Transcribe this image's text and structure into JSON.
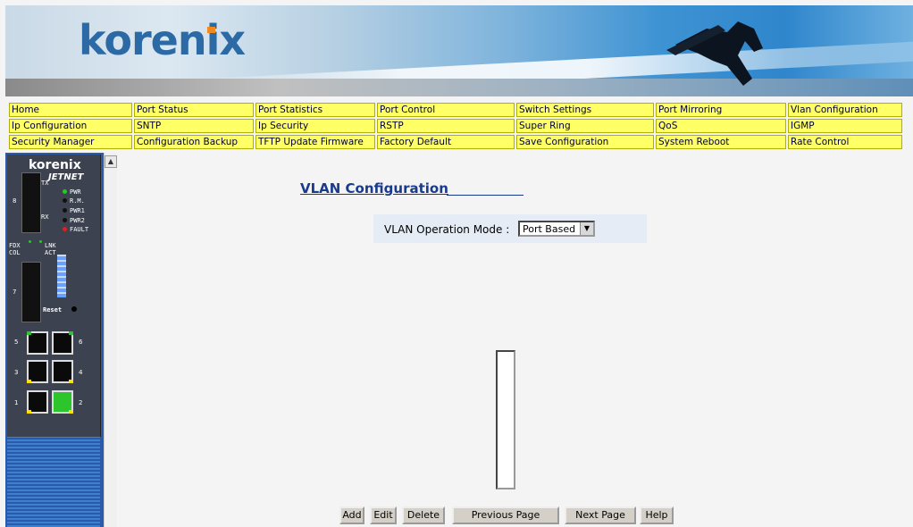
{
  "brand": {
    "logo_text": "korenix"
  },
  "menu": {
    "rows": [
      [
        "Home",
        "Port Status",
        "Port Statistics",
        "Port Control",
        "Switch Settings",
        "Port Mirroring",
        "Vlan Configuration"
      ],
      [
        "Ip Configuration",
        "SNTP",
        "Ip Security",
        "RSTP",
        "Super Ring",
        "QoS",
        "IGMP"
      ],
      [
        "Security Manager",
        "Configuration Backup",
        "TFTP Update Firmware",
        "Factory Default",
        "Save Configuration",
        "System Reboot",
        "Rate Control"
      ]
    ]
  },
  "device": {
    "logo": "korenix",
    "model": "JETNET",
    "leds": [
      "PWR",
      "R.M.",
      "PWR1",
      "PWR2",
      "FAULT"
    ],
    "fdx_label": "FDX COL",
    "lnk_label": "LNK ACT",
    "reset_label": "Reset",
    "fiber_tx": "TX",
    "fiber_rx": "RX",
    "ports": [
      "8",
      "7",
      "5",
      "6",
      "3",
      "4",
      "1",
      "2"
    ]
  },
  "main": {
    "title": "VLAN Configuration",
    "mode_label": "VLAN Operation Mode :",
    "mode_value": "Port Based"
  },
  "buttons": {
    "add": "Add",
    "edit": "Edit",
    "delete": "Delete",
    "previous": "Previous Page",
    "next": "Next Page",
    "help": "Help"
  }
}
